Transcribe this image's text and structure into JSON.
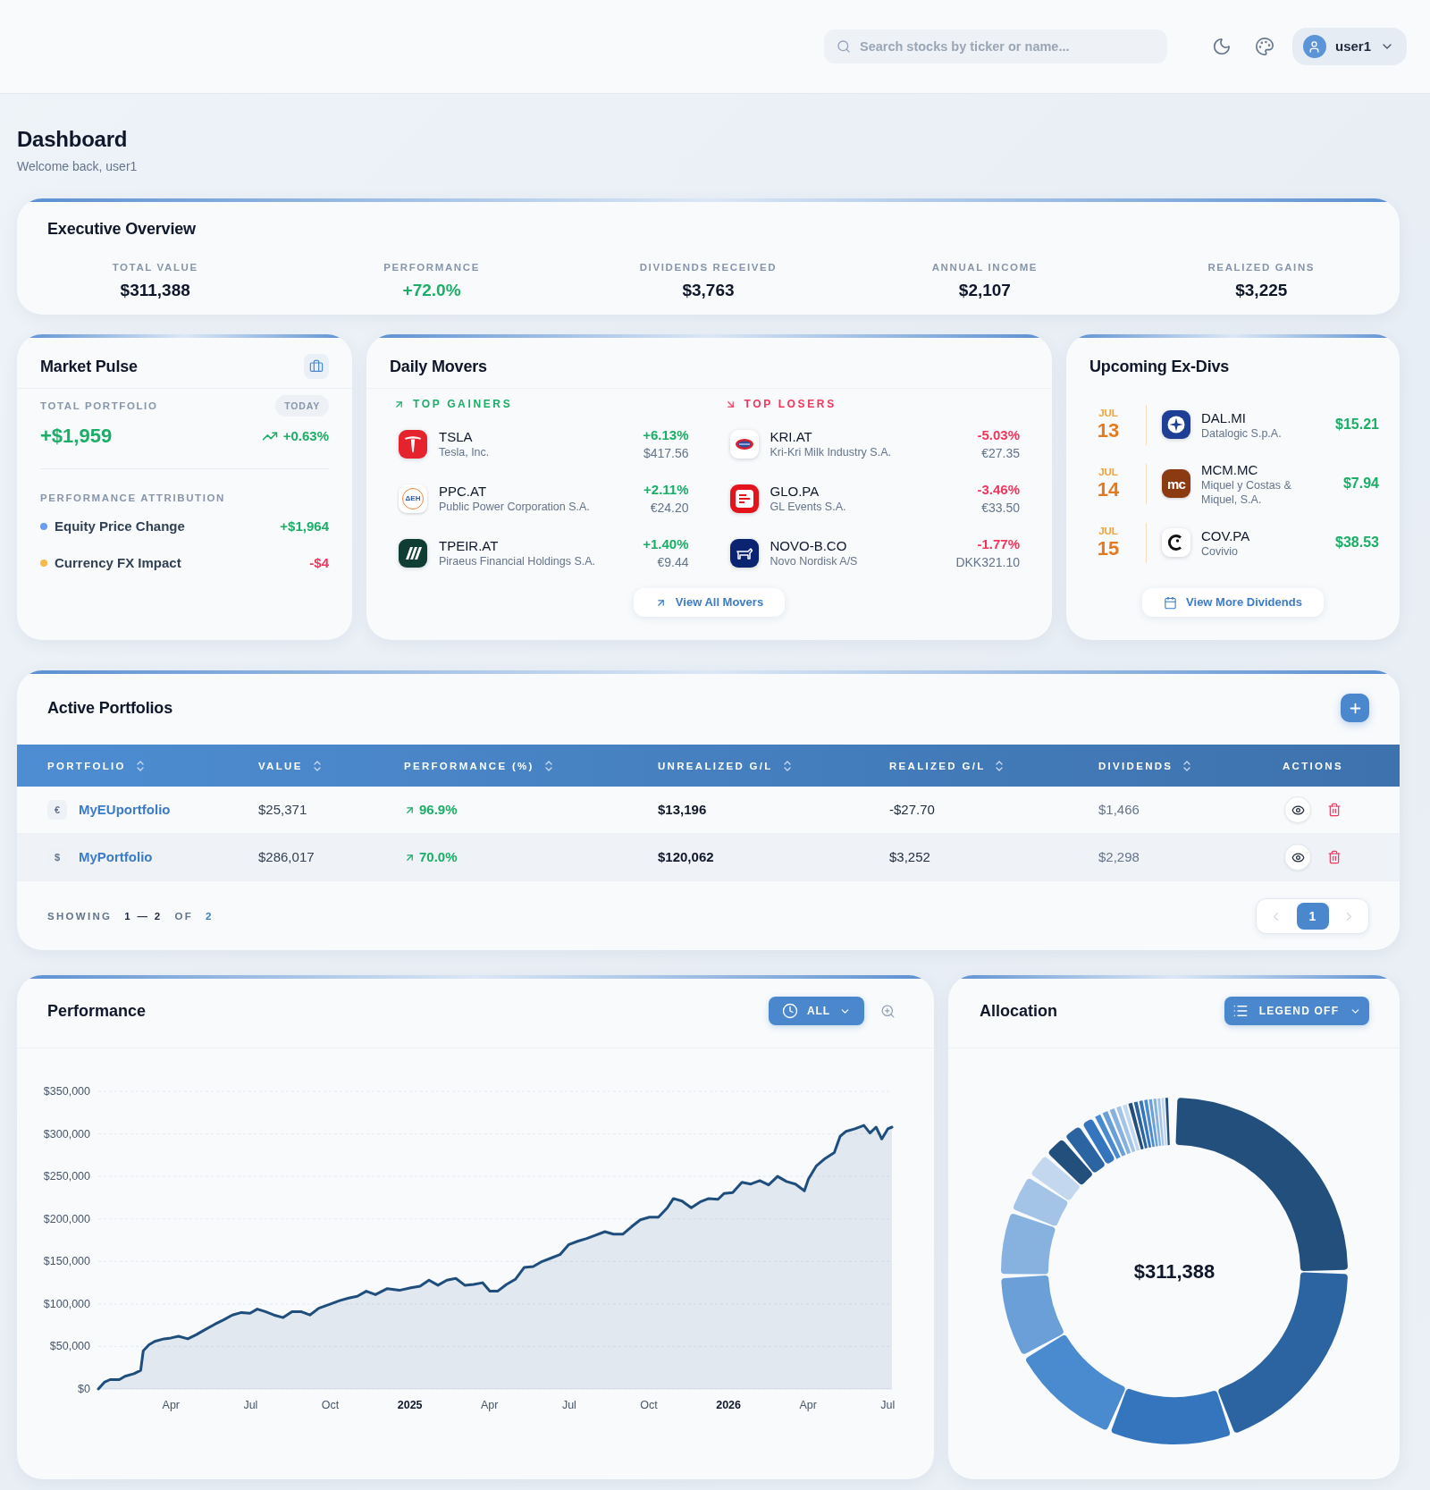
{
  "header": {
    "search": {
      "placeholder": "Search stocks by ticker or name..."
    },
    "user": {
      "name": "user1"
    }
  },
  "page": {
    "title": "Dashboard",
    "subtitle": "Welcome back, user1"
  },
  "executive_overview": {
    "title": "Executive Overview",
    "stats": [
      {
        "label": "TOTAL VALUE",
        "value": "$311,388",
        "positive": false
      },
      {
        "label": "PERFORMANCE",
        "value": "+72.0%",
        "positive": true
      },
      {
        "label": "DIVIDENDS RECEIVED",
        "value": "$3,763",
        "positive": false
      },
      {
        "label": "ANNUAL INCOME",
        "value": "$2,107",
        "positive": false
      },
      {
        "label": "REALIZED GAINS",
        "value": "$3,225",
        "positive": false
      }
    ]
  },
  "market_pulse": {
    "title": "Market Pulse",
    "total_label": "TOTAL PORTFOLIO",
    "period": "TODAY",
    "change": "+$1,959",
    "change_pct": "+0.63%",
    "positive": true,
    "attribution_title": "PERFORMANCE ATTRIBUTION",
    "attribution": [
      {
        "label": "Equity Price Change",
        "value": "+$1,964",
        "color": "#6b9ef2",
        "positive": true
      },
      {
        "label": "Currency FX Impact",
        "value": "-$4",
        "color": "#f6b94c",
        "positive": false
      }
    ]
  },
  "daily_movers": {
    "title": "Daily Movers",
    "groups": [
      {
        "title": "TOP GAINERS",
        "positive": true,
        "items": [
          {
            "ticker": "TSLA",
            "name": "Tesla, Inc.",
            "change": "+6.13%",
            "price": "$417.56",
            "logo": {
              "kind": "tee"
            }
          },
          {
            "ticker": "PPC.AT",
            "name": "Public Power Corporation S.A.",
            "change": "+2.11%",
            "price": "€24.20",
            "logo": {
              "kind": "ring",
              "text": "ΔΕΗ"
            }
          },
          {
            "ticker": "TPEIR.AT",
            "name": "Piraeus Financial Holdings S.A.",
            "change": "+1.40%",
            "price": "€9.44",
            "logo": {
              "kind": "slashes"
            }
          }
        ]
      },
      {
        "title": "TOP LOSERS",
        "positive": false,
        "items": [
          {
            "ticker": "KRI.AT",
            "name": "Kri-Kri Milk Industry S.A.",
            "change": "-5.03%",
            "price": "€27.35",
            "logo": {
              "kind": "oval"
            }
          },
          {
            "ticker": "GLO.PA",
            "name": "GL Events S.A.",
            "change": "-3.46%",
            "price": "€33.50",
            "logo": {
              "kind": "frame"
            }
          },
          {
            "ticker": "NOVO-B.CO",
            "name": "Novo Nordisk A/S",
            "change": "-1.77%",
            "price": "DKK321.10",
            "logo": {
              "kind": "bull"
            }
          }
        ]
      }
    ],
    "button": "View All Movers"
  },
  "ex_dividends": {
    "title": "Upcoming Ex-Divs",
    "items": [
      {
        "month": "JUL",
        "day": "13",
        "ticker": "DAL.MI",
        "name": "Datalogic S.p.A.",
        "amount": "$15.21",
        "logo": {
          "kind": "star"
        }
      },
      {
        "month": "JUL",
        "day": "14",
        "ticker": "MCM.MC",
        "name": "Miquel y Costas & Miquel, S.A.",
        "amount": "$7.94",
        "logo": {
          "kind": "letters",
          "text": "mc"
        }
      },
      {
        "month": "JUL",
        "day": "15",
        "ticker": "COV.PA",
        "name": "Covivio",
        "amount": "$38.53",
        "logo": {
          "kind": "crescent"
        }
      }
    ],
    "button": "View More Dividends"
  },
  "active_portfolios": {
    "title": "Active Portfolios",
    "columns": [
      {
        "label": "PORTFOLIO",
        "sortable": true
      },
      {
        "label": "VALUE",
        "sortable": true
      },
      {
        "label": "PERFORMANCE (%)",
        "sortable": true
      },
      {
        "label": "UNREALIZED G/L",
        "sortable": true
      },
      {
        "label": "REALIZED G/L",
        "sortable": true
      },
      {
        "label": "DIVIDENDS",
        "sortable": true
      },
      {
        "label": "ACTIONS",
        "sortable": false
      }
    ],
    "rows": [
      {
        "currency": "€",
        "name": "MyEUportfolio",
        "value": "$25,371",
        "performance": "96.9%",
        "positive": true,
        "unrealized": "$13,196",
        "realized": "-$27.70",
        "dividends": "$1,466"
      },
      {
        "currency": "$",
        "name": "MyPortfolio",
        "value": "$286,017",
        "performance": "70.0%",
        "positive": true,
        "unrealized": "$120,062",
        "realized": "$3,252",
        "dividends": "$2,298"
      }
    ],
    "pagination": {
      "showing_label": "SHOWING",
      "range": "1 — 2",
      "of_label": "OF",
      "total": "2",
      "prev_disabled": true,
      "next_disabled": true,
      "pages": [
        {
          "label": "1",
          "selected": true
        }
      ]
    }
  },
  "performance": {
    "title": "Performance",
    "range_button": "ALL",
    "chart_data": {
      "type": "area",
      "grid": true,
      "x": [
        2024.022,
        2024.041,
        2024.059,
        2024.088,
        2024.106,
        2024.134,
        2024.155,
        2024.163,
        2024.181,
        2024.199,
        2024.228,
        2024.25,
        2024.274,
        2024.303,
        2024.33,
        2024.358,
        2024.387,
        2024.414,
        2024.443,
        2024.471,
        2024.498,
        2024.521,
        2024.546,
        2024.573,
        2024.602,
        2024.63,
        2024.658,
        2024.686,
        2024.714,
        2024.751,
        2024.779,
        2024.808,
        2024.835,
        2024.863,
        2024.892,
        2024.929,
        2024.967,
        2025.003,
        2025.032,
        2025.06,
        2025.088,
        2025.116,
        2025.144,
        2025.172,
        2025.2,
        2025.228,
        2025.251,
        2025.275,
        2025.303,
        2025.331,
        2025.359,
        2025.387,
        2025.415,
        2025.443,
        2025.471,
        2025.499,
        2025.528,
        2025.555,
        2025.583,
        2025.612,
        2025.639,
        2025.668,
        2025.696,
        2025.723,
        2025.752,
        2025.78,
        2025.808,
        2025.827,
        2025.854,
        2025.883,
        2025.911,
        2025.938,
        2025.967,
        2025.986,
        2026.013,
        2026.042,
        2026.07,
        2026.098,
        2026.126,
        2026.154,
        2026.182,
        2026.21,
        2026.238,
        2026.251,
        2026.275,
        2026.303,
        2026.332,
        2026.35,
        2026.369,
        2026.397,
        2026.425,
        2026.444,
        2026.463,
        2026.481,
        2026.5,
        2026.513
      ],
      "series": [
        {
          "color": "#1f4e7d",
          "values": [
            0,
            8000,
            11000,
            11000,
            15000,
            18000,
            22000,
            45000,
            52000,
            56000,
            59000,
            60000,
            62000,
            59000,
            64000,
            70000,
            76000,
            81000,
            87000,
            90000,
            89000,
            94000,
            91000,
            87000,
            84000,
            91000,
            91000,
            87000,
            95000,
            100000,
            104000,
            107000,
            109000,
            115000,
            111000,
            118000,
            116000,
            119000,
            121000,
            128000,
            122000,
            128000,
            130000,
            122000,
            123000,
            125000,
            115000,
            115000,
            123000,
            129000,
            143000,
            144000,
            150000,
            154000,
            158000,
            170000,
            174000,
            177000,
            181000,
            185000,
            182000,
            182000,
            191000,
            199000,
            202000,
            202000,
            213000,
            224000,
            221000,
            213000,
            220000,
            224000,
            223000,
            230000,
            231000,
            243000,
            241000,
            245000,
            240000,
            250000,
            244000,
            241000,
            233000,
            247000,
            262000,
            271000,
            278000,
            297000,
            303000,
            306000,
            310000,
            301000,
            308000,
            294000,
            306000,
            308000
          ]
        }
      ],
      "xlim": [
        2024.022,
        2026.513
      ],
      "ylim": [
        0,
        350000
      ],
      "xticks": [
        {
          "value": 2024.25,
          "label": "Apr"
        },
        {
          "value": 2024.5,
          "label": "Jul"
        },
        {
          "value": 2024.75,
          "label": "Oct"
        },
        2025,
        {
          "value": 2025.25,
          "label": "Apr"
        },
        {
          "value": 2025.5,
          "label": "Jul"
        },
        {
          "value": 2025.75,
          "label": "Oct"
        },
        2026,
        {
          "value": 2026.25,
          "label": "Apr"
        },
        {
          "value": 2026.5,
          "label": "Jul"
        }
      ],
      "yticks": [
        {
          "value": 0,
          "label": "$0"
        },
        {
          "value": 50000,
          "label": "$50,000"
        },
        {
          "value": 100000,
          "label": "$100,000"
        },
        {
          "value": 150000,
          "label": "$150,000"
        },
        {
          "value": 200000,
          "label": "$200,000"
        },
        {
          "value": 250000,
          "label": "$250,000"
        },
        {
          "value": 300000,
          "label": "$300,000"
        },
        {
          "value": 350000,
          "label": "$350,000"
        }
      ]
    }
  },
  "allocation": {
    "title": "Allocation",
    "legend_button": "LEGEND OFF",
    "total": "$311,388"
  }
}
